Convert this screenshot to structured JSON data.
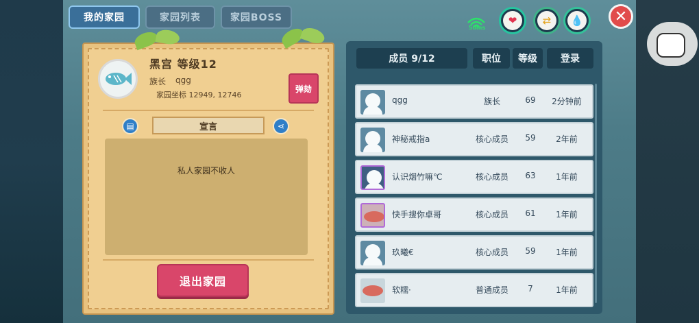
{
  "tabs": [
    {
      "label": "我的家园",
      "active": true
    },
    {
      "label": "家园列表",
      "active": false
    },
    {
      "label": "家园BOSS",
      "active": false
    }
  ],
  "status": {
    "ping_label": "50ms",
    "icons": [
      "heart-icon",
      "swap-icon",
      "water-drop-icon"
    ],
    "close_label": "✕"
  },
  "garden": {
    "name_level": "黑宫 等级12",
    "leader_label": "族长",
    "leader_name": "qgg",
    "coord_label": "家园坐标 12949, 12746",
    "impeach_label": "弹劾",
    "declaration_title": "宣言",
    "declaration_text": "私人家园不收人",
    "quit_label": "退出家园"
  },
  "members_header": {
    "count_label": "成员 9/12",
    "role_label": "职位",
    "level_label": "等级",
    "login_label": "登录"
  },
  "members": [
    {
      "name": "qgg",
      "role": "族长",
      "level": "69",
      "login": "2分钟前",
      "avatar": "default"
    },
    {
      "name": "神秘戒指a",
      "role": "核心成员",
      "level": "59",
      "login": "2年前",
      "avatar": "default"
    },
    {
      "name": "认识烟竹嘛℃",
      "role": "核心成员",
      "level": "63",
      "login": "1年前",
      "avatar": "purple"
    },
    {
      "name": "快手搜你卓哥",
      "role": "核心成员",
      "level": "61",
      "login": "1年前",
      "avatar": "fish"
    },
    {
      "name": "玖曦€",
      "role": "核心成员",
      "level": "59",
      "login": "1年前",
      "avatar": "default"
    },
    {
      "name": "软糯·",
      "role": "普通成员",
      "level": "7",
      "login": "1年前",
      "avatar": "fish"
    }
  ],
  "colors": {
    "primary_button": "#d9466a",
    "tab_active": "#3a6f99",
    "panel_parchment": "#e8c27f"
  }
}
